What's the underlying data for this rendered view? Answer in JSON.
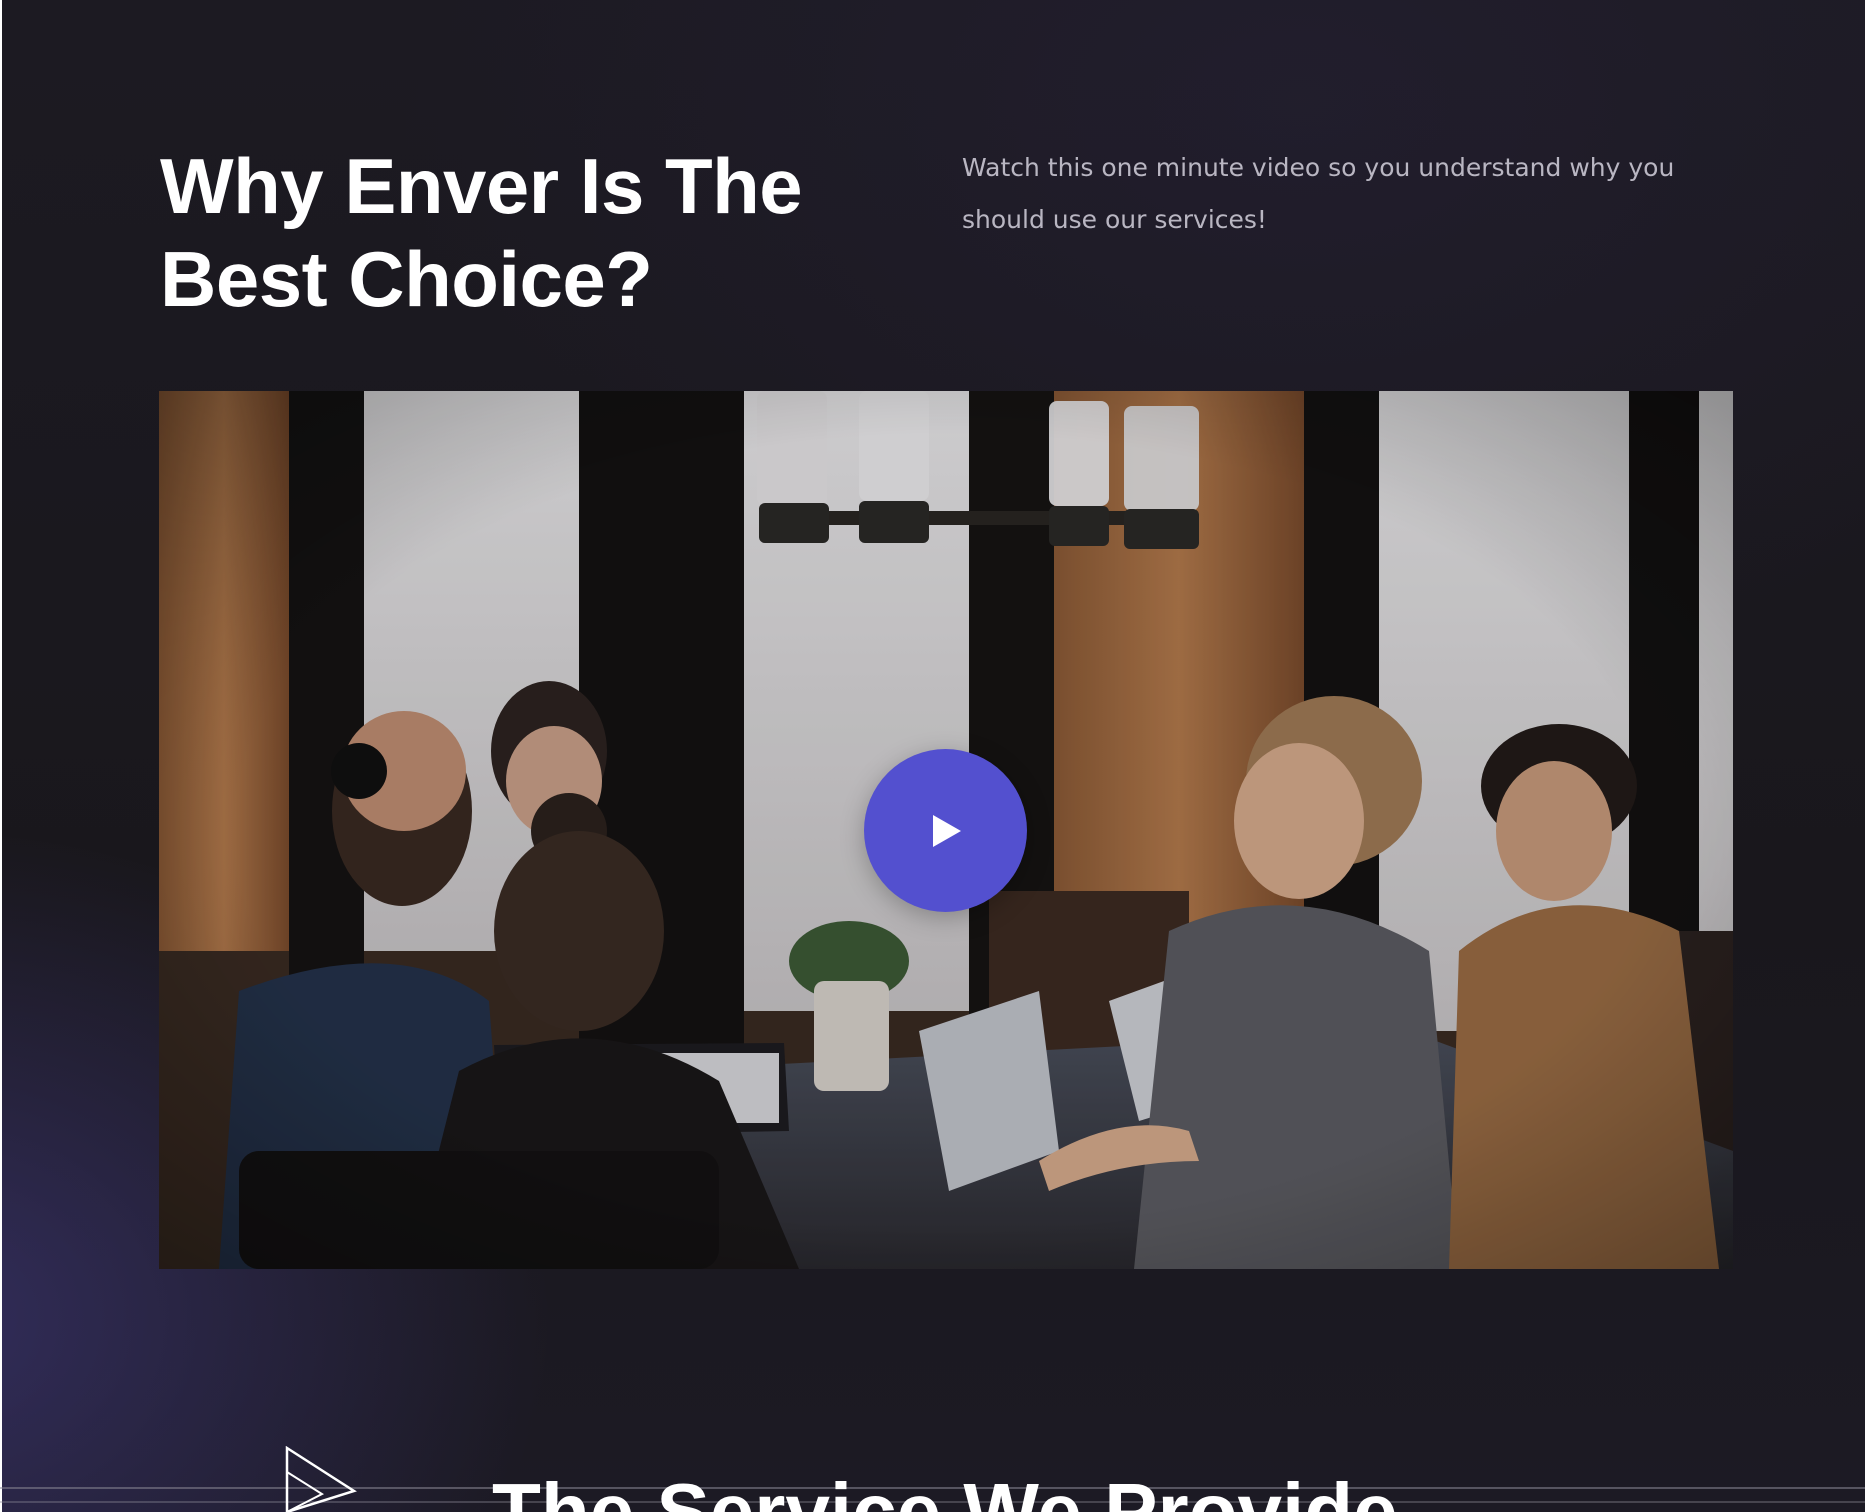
{
  "section": {
    "heading": "Why Enver Is The Best Choice?",
    "lead": "Watch this one minute video so you understand why you should use our services!"
  },
  "video": {
    "thumbnail": "team-meeting-photo",
    "play_icon": "play-icon",
    "accent_color": "#5350cf"
  },
  "next_section": {
    "title": "The Service We Provide",
    "icon": "play-outline-icon"
  },
  "colors": {
    "background": "#1b1920",
    "heading_text": "#ffffff",
    "body_text": "#b9b6c2",
    "accent": "#5350cf"
  }
}
